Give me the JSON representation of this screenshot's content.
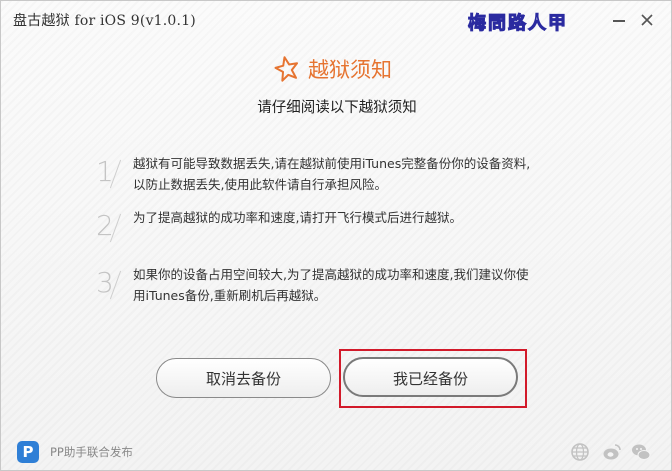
{
  "window": {
    "title": "盘古越狱 for iOS 9(v1.0.1)",
    "watermark": "梅問路人甲"
  },
  "notice": {
    "heading": "越狱须知",
    "subheading": "请仔细阅读以下越狱须知",
    "items": [
      {
        "number": "1",
        "line1": "越狱有可能导致数据丢失,请在越狱前使用iTunes完整备份你的设备资料,",
        "line2": "以防止数据丢失,使用此软件请自行承担风险。"
      },
      {
        "number": "2",
        "line1": "为了提高越狱的成功率和速度,请打开飞行模式后进行越狱。",
        "line2": ""
      },
      {
        "number": "3",
        "line1": "如果你的设备占用空间较大,为了提高越狱的成功率和速度,我们建议你使",
        "line2": "用iTunes备份,重新刷机后再越狱。"
      }
    ]
  },
  "buttons": {
    "cancel": "取消去备份",
    "confirm": "我已经备份"
  },
  "footer": {
    "logo_letter": "P",
    "text": "PP助手联合发布",
    "icons": [
      "globe-icon",
      "weibo-icon",
      "chat-icon"
    ]
  },
  "colors": {
    "accent": "#e67431",
    "highlight_border": "#d21a2a",
    "pp_blue": "#2f7fd6"
  }
}
